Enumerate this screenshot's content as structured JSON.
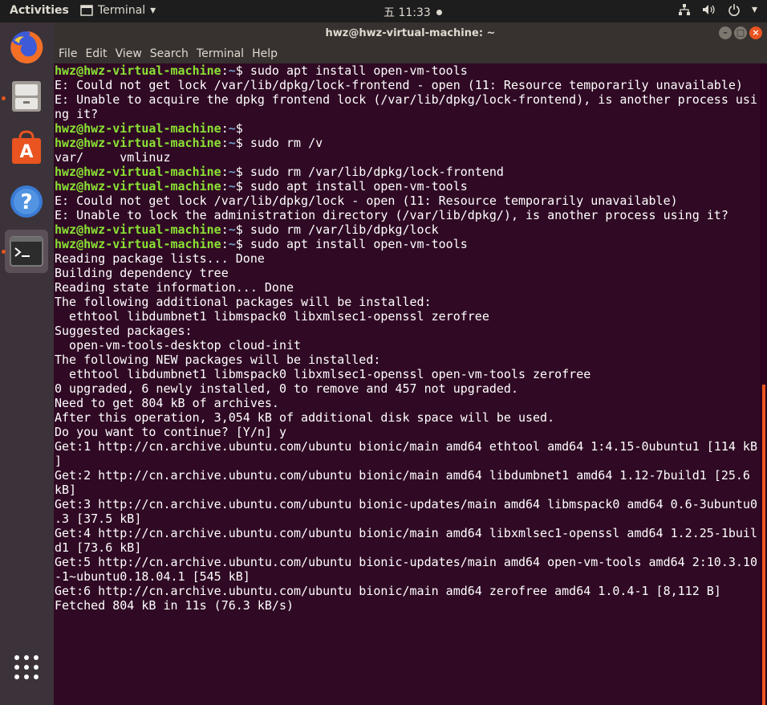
{
  "topbar": {
    "activities": "Activities",
    "app_name": "Terminal",
    "clock": "五 11:33"
  },
  "window": {
    "title": "hwz@hwz-virtual-machine: ~"
  },
  "menu": [
    "File",
    "Edit",
    "View",
    "Search",
    "Terminal",
    "Help"
  ],
  "prompt": {
    "user": "hwz@hwz-virtual-machine",
    "path": "~"
  },
  "terminal_lines": [
    {
      "type": "prompt",
      "cmd": " sudo apt install open-vm-tools"
    },
    {
      "type": "out",
      "text": "E: Could not get lock /var/lib/dpkg/lock-frontend - open (11: Resource temporarily unavailable)"
    },
    {
      "type": "out",
      "text": "E: Unable to acquire the dpkg frontend lock (/var/lib/dpkg/lock-frontend), is another process usi"
    },
    {
      "type": "out",
      "text": "ng it?"
    },
    {
      "type": "prompt",
      "cmd": ""
    },
    {
      "type": "prompt",
      "cmd": " sudo rm /v"
    },
    {
      "type": "out",
      "text": "var/     vmlinuz"
    },
    {
      "type": "prompt",
      "cmd": " sudo rm /var/lib/dpkg/lock-frontend"
    },
    {
      "type": "prompt",
      "cmd": " sudo apt install open-vm-tools"
    },
    {
      "type": "out",
      "text": "E: Could not get lock /var/lib/dpkg/lock - open (11: Resource temporarily unavailable)"
    },
    {
      "type": "out",
      "text": "E: Unable to lock the administration directory (/var/lib/dpkg/), is another process using it?"
    },
    {
      "type": "prompt",
      "cmd": " sudo rm /var/lib/dpkg/lock"
    },
    {
      "type": "prompt",
      "cmd": " sudo apt install open-vm-tools"
    },
    {
      "type": "out",
      "text": "Reading package lists... Done"
    },
    {
      "type": "out",
      "text": "Building dependency tree"
    },
    {
      "type": "out",
      "text": "Reading state information... Done"
    },
    {
      "type": "out",
      "text": "The following additional packages will be installed:"
    },
    {
      "type": "out",
      "text": "  ethtool libdumbnet1 libmspack0 libxmlsec1-openssl zerofree"
    },
    {
      "type": "out",
      "text": "Suggested packages:"
    },
    {
      "type": "out",
      "text": "  open-vm-tools-desktop cloud-init"
    },
    {
      "type": "out",
      "text": "The following NEW packages will be installed:"
    },
    {
      "type": "out",
      "text": "  ethtool libdumbnet1 libmspack0 libxmlsec1-openssl open-vm-tools zerofree"
    },
    {
      "type": "out",
      "text": "0 upgraded, 6 newly installed, 0 to remove and 457 not upgraded."
    },
    {
      "type": "out",
      "text": "Need to get 804 kB of archives."
    },
    {
      "type": "out",
      "text": "After this operation, 3,054 kB of additional disk space will be used."
    },
    {
      "type": "out",
      "text": "Do you want to continue? [Y/n] y"
    },
    {
      "type": "out",
      "text": "Get:1 http://cn.archive.ubuntu.com/ubuntu bionic/main amd64 ethtool amd64 1:4.15-0ubuntu1 [114 kB"
    },
    {
      "type": "out",
      "text": "]"
    },
    {
      "type": "out",
      "text": "Get:2 http://cn.archive.ubuntu.com/ubuntu bionic/main amd64 libdumbnet1 amd64 1.12-7build1 [25.6"
    },
    {
      "type": "out",
      "text": "kB]"
    },
    {
      "type": "out",
      "text": "Get:3 http://cn.archive.ubuntu.com/ubuntu bionic-updates/main amd64 libmspack0 amd64 0.6-3ubuntu0"
    },
    {
      "type": "out",
      "text": ".3 [37.5 kB]"
    },
    {
      "type": "out",
      "text": "Get:4 http://cn.archive.ubuntu.com/ubuntu bionic/main amd64 libxmlsec1-openssl amd64 1.2.25-1buil"
    },
    {
      "type": "out",
      "text": "d1 [73.6 kB]"
    },
    {
      "type": "out",
      "text": "Get:5 http://cn.archive.ubuntu.com/ubuntu bionic-updates/main amd64 open-vm-tools amd64 2:10.3.10"
    },
    {
      "type": "out",
      "text": "-1~ubuntu0.18.04.1 [545 kB]"
    },
    {
      "type": "out",
      "text": "Get:6 http://cn.archive.ubuntu.com/ubuntu bionic/main amd64 zerofree amd64 1.0.4-1 [8,112 B]"
    },
    {
      "type": "out",
      "text": "Fetched 804 kB in 11s (76.3 kB/s)"
    }
  ],
  "colors": {
    "terminal_bg": "#300a24",
    "prompt_user": "#8ae234",
    "prompt_path": "#729fcf",
    "accent": "#e95420"
  },
  "dock_icons": [
    "firefox-icon",
    "files-icon",
    "software-icon",
    "help-icon",
    "terminal-icon",
    "apps-grid-icon"
  ]
}
